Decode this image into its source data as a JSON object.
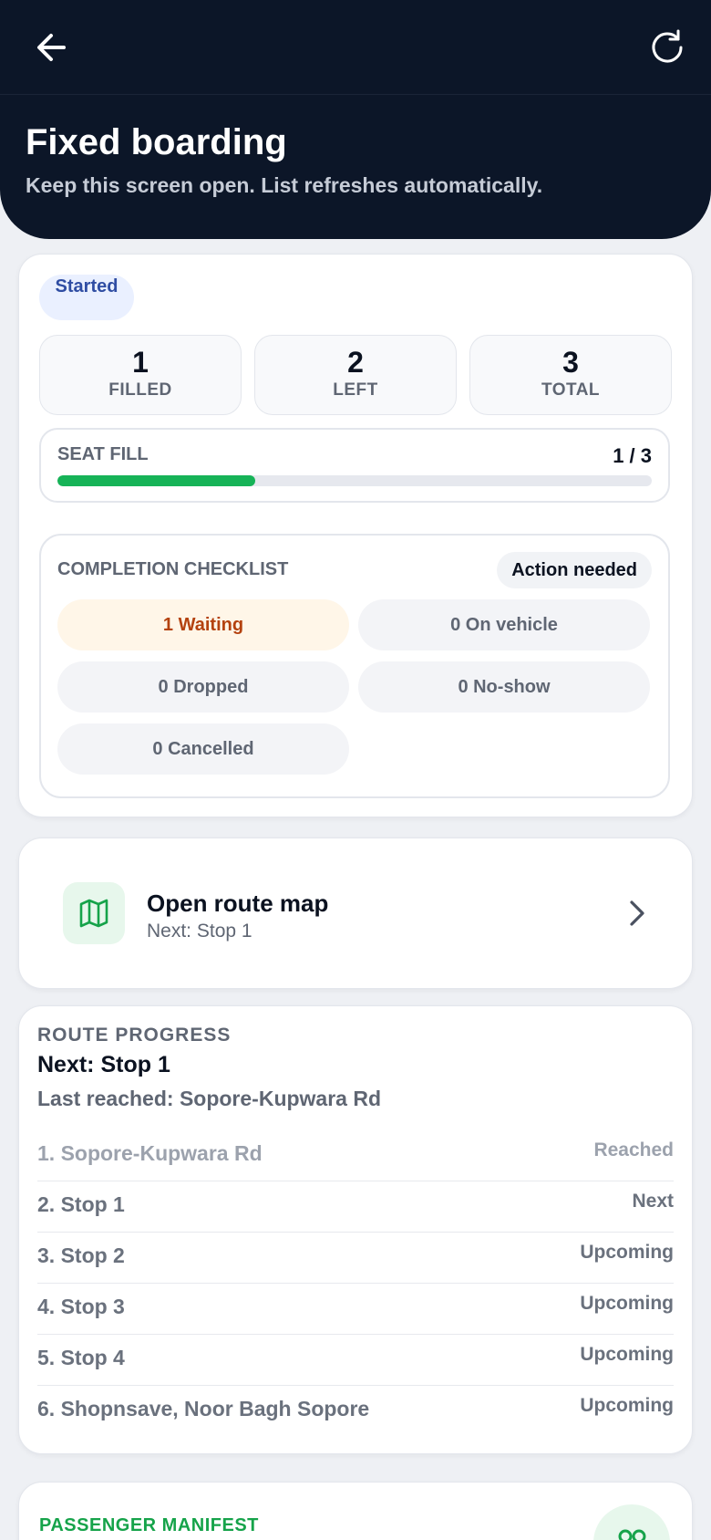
{
  "header": {
    "back_icon": "arrow-left-icon",
    "refresh_icon": "refresh-icon",
    "title": "Fixed boarding",
    "subtitle": "Keep this screen open. List refreshes automatically."
  },
  "status": {
    "badge": "Started",
    "stats": [
      {
        "value": "1",
        "label": "FILLED"
      },
      {
        "value": "2",
        "label": "LEFT"
      },
      {
        "value": "3",
        "label": "TOTAL"
      }
    ],
    "seat_fill": {
      "label": "SEAT FILL",
      "value": "1 / 3",
      "fraction": 0.3333
    },
    "checklist": {
      "title": "COMPLETION CHECKLIST",
      "badge": "Action needed",
      "chips": [
        {
          "label": "1 Waiting",
          "state": "warn"
        },
        {
          "label": "0 On vehicle",
          "state": "neutral"
        },
        {
          "label": "0 Dropped",
          "state": "neutral"
        },
        {
          "label": "0 No-show",
          "state": "neutral"
        },
        {
          "label": "0 Cancelled",
          "state": "neutral"
        }
      ]
    }
  },
  "route_map": {
    "icon": "map-icon",
    "title": "Open route map",
    "subtitle": "Next: Stop 1",
    "chevron_icon": "chevron-right-icon"
  },
  "route_progress": {
    "kicker": "ROUTE PROGRESS",
    "next": "Next: Stop 1",
    "last_reached": "Last reached: Sopore-Kupwara Rd",
    "stops": [
      {
        "name": "1. Sopore-Kupwara Rd",
        "state": "Reached"
      },
      {
        "name": "2. Stop 1",
        "state": "Next"
      },
      {
        "name": "3. Stop 2",
        "state": "Upcoming"
      },
      {
        "name": "4. Stop 3",
        "state": "Upcoming"
      },
      {
        "name": "5. Stop 4",
        "state": "Upcoming"
      },
      {
        "name": "6. Shopnsave, Noor Bagh Sopore",
        "state": "Upcoming"
      }
    ]
  },
  "manifest": {
    "title": "PASSENGER MANIFEST",
    "icon": "users-icon"
  },
  "colors": {
    "header_bg": "#0c1628",
    "accent_green": "#16b357",
    "warn_text": "#b4420f",
    "started_text": "#2f4da3"
  }
}
